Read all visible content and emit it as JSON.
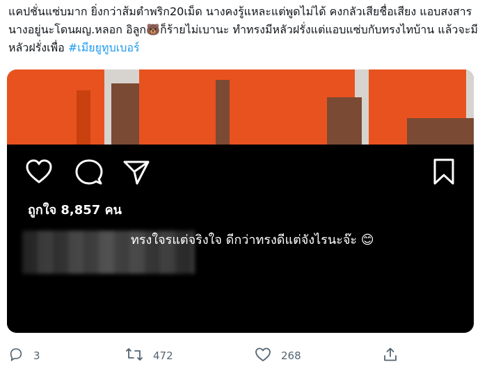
{
  "tweet": {
    "text": "แคปชั่นแซ่บมาก ยิ่งกว่าส้มตำพริก20เม็ด นางคงรู้แหละแต่พูดไม่ได้ คงกลัวเสียชื่อเสียง แอบสงสารนางอยู่นะโดนผญ.หลอก อิลูก🐻ก็ร้ายไม่เบานะ ทำทรงมีหลัวฝรั่งแต่แอบแซ่บกับทรงไทบ้าน แล้วจะมีหลัวฝรั่งเพื่อ",
    "hashtag": "#เมียยูทูบเบอร์"
  },
  "instagram_post": {
    "likes_label": "ถูกใจ 8,857 คน",
    "caption": "ทรงใจรแต่จริงใจ ดีกว่าทรงดีแต่จังไรนะจ๊ะ 😊",
    "icons": [
      "heart-icon",
      "comment-icon",
      "share-icon",
      "bookmark-icon"
    ]
  },
  "actions": {
    "reply_count": "3",
    "retweet_count": "472",
    "like_count": "268"
  },
  "colors": {
    "hashtag": "#1d9bf0",
    "action_gray": "#536471",
    "uniform_orange": "#e8521f"
  }
}
